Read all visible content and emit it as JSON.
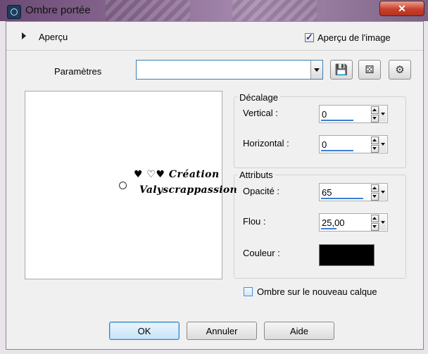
{
  "window": {
    "title": "Ombre portée",
    "close_symbol": "✕"
  },
  "preview_section": {
    "label": "Aperçu",
    "image_preview_label": "Aperçu de l'image",
    "image_preview_checked": true
  },
  "presets": {
    "label": "Paramètres",
    "value": "",
    "buttons": [
      {
        "icon": "save-icon",
        "glyph": "💾"
      },
      {
        "icon": "dice-icon",
        "glyph": "⚄"
      },
      {
        "icon": "preset-manager-icon",
        "glyph": "⚙"
      }
    ]
  },
  "watermark": {
    "line1": "♥ ♡♥ Création",
    "line2": "Valyscrappassion"
  },
  "offset": {
    "title": "Décalage",
    "vertical_label": "Vertical :",
    "vertical_value": "0",
    "horizontal_label": "Horizontal :",
    "horizontal_value": "0"
  },
  "attributes": {
    "title": "Attributs",
    "opacity_label": "Opacité :",
    "opacity_value": "65",
    "blur_label": "Flou :",
    "blur_value": "25,00",
    "color_label": "Couleur :",
    "color": "#000000"
  },
  "new_layer": {
    "label": "Ombre sur le nouveau calque",
    "checked": false
  },
  "buttons": {
    "ok": "OK",
    "cancel": "Annuler",
    "help": "Aide"
  },
  "colors": {
    "title_gradient_start": "#6a4a74",
    "close_red": "#c8412c",
    "focus_blue": "#3c7fb1",
    "slider_blue": "#3a7fd6"
  }
}
